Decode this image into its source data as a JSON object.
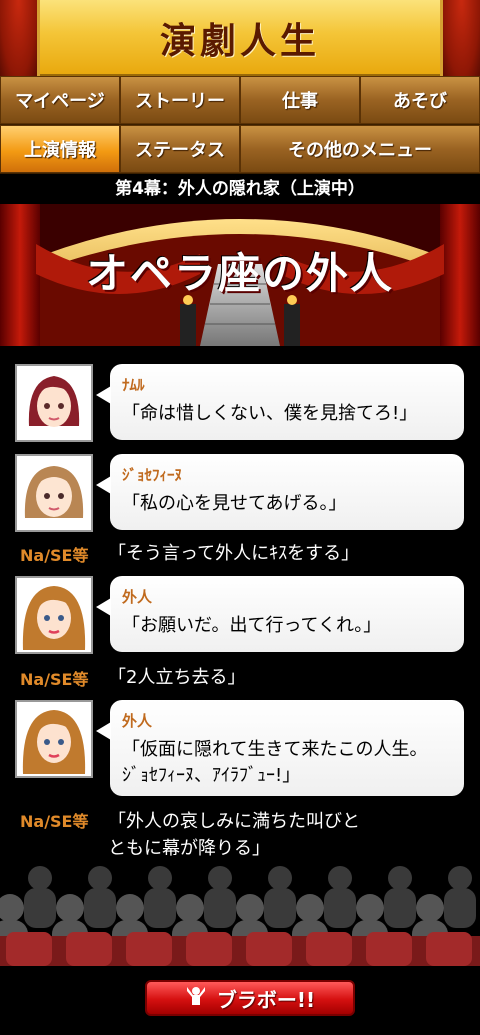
{
  "header": {
    "title": "演劇人生"
  },
  "nav": {
    "row1": [
      "マイページ",
      "ストーリー",
      "仕事",
      "あそび"
    ],
    "row2": [
      "上演情報",
      "ステータス",
      "その他のメニュー"
    ]
  },
  "act_title": "第4幕：外人の隠れ家（上演中）",
  "banner": {
    "title": "オペラ座の外人"
  },
  "dialogs": [
    {
      "speaker": "ﾅﾑﾙ",
      "text": "「命は惜しくない、僕を見捨てろ!」"
    },
    {
      "speaker": "ｼﾞｮｾﾌｨｰﾇ",
      "text": "「私の心を見せてあげる。」"
    },
    {
      "speaker": "外人",
      "text": "「お願いだ。出て行ってくれ。」"
    },
    {
      "speaker": "外人",
      "text1": "「仮面に隠れて生きて来たこの人生。",
      "text2": "ｼﾞｮｾﾌｨｰﾇ、ｱｲﾗﾌﾞｭｰ!」"
    }
  ],
  "narrations": [
    {
      "tag": "Na/SE等",
      "text": "「そう言って外人にｷｽをする」"
    },
    {
      "tag": "Na/SE等",
      "text": "「2人立ち去る」"
    },
    {
      "tag": "Na/SE等",
      "text1": "「外人の哀しみに満ちた叫びと",
      "text2": "ともに幕が降りる」"
    }
  ],
  "footer": {
    "bravo_label": "ブラボー!!"
  },
  "colors": {
    "accent_orange": "#f39a13",
    "bravo_red": "#d51010",
    "speaker": "#c06a1e",
    "narr_tag": "#e08a2a"
  }
}
